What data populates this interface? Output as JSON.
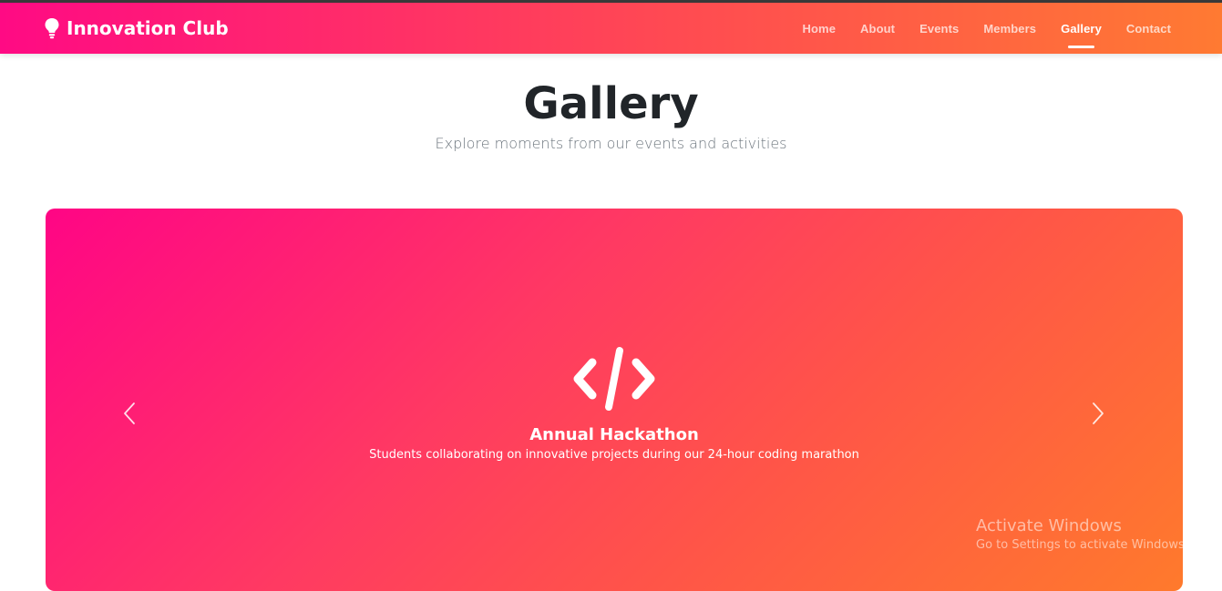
{
  "brand": {
    "name": "Innovation Club",
    "icon": "lightbulb-icon"
  },
  "nav": {
    "items": [
      {
        "label": "Home",
        "active": false
      },
      {
        "label": "About",
        "active": false
      },
      {
        "label": "Events",
        "active": false
      },
      {
        "label": "Members",
        "active": false
      },
      {
        "label": "Gallery",
        "active": true
      },
      {
        "label": "Contact",
        "active": false
      }
    ]
  },
  "header": {
    "title": "Gallery",
    "subtitle": "Explore moments from our events and activities"
  },
  "carousel": {
    "slide": {
      "icon": "code-icon",
      "title": "Annual Hackathon",
      "caption": "Students collaborating on innovative projects during our 24-hour coding marathon"
    },
    "prev_icon": "chevron-left-icon",
    "next_icon": "chevron-right-icon"
  },
  "watermark": {
    "title": "Activate Windows",
    "subtitle": "Go to Settings to activate Windows."
  },
  "colors": {
    "gradient_start": "#ff0a84",
    "gradient_mid": "#ff4a52",
    "gradient_end": "#ff7a32",
    "title_text": "#212529",
    "subtitle_text": "#6c757d"
  }
}
